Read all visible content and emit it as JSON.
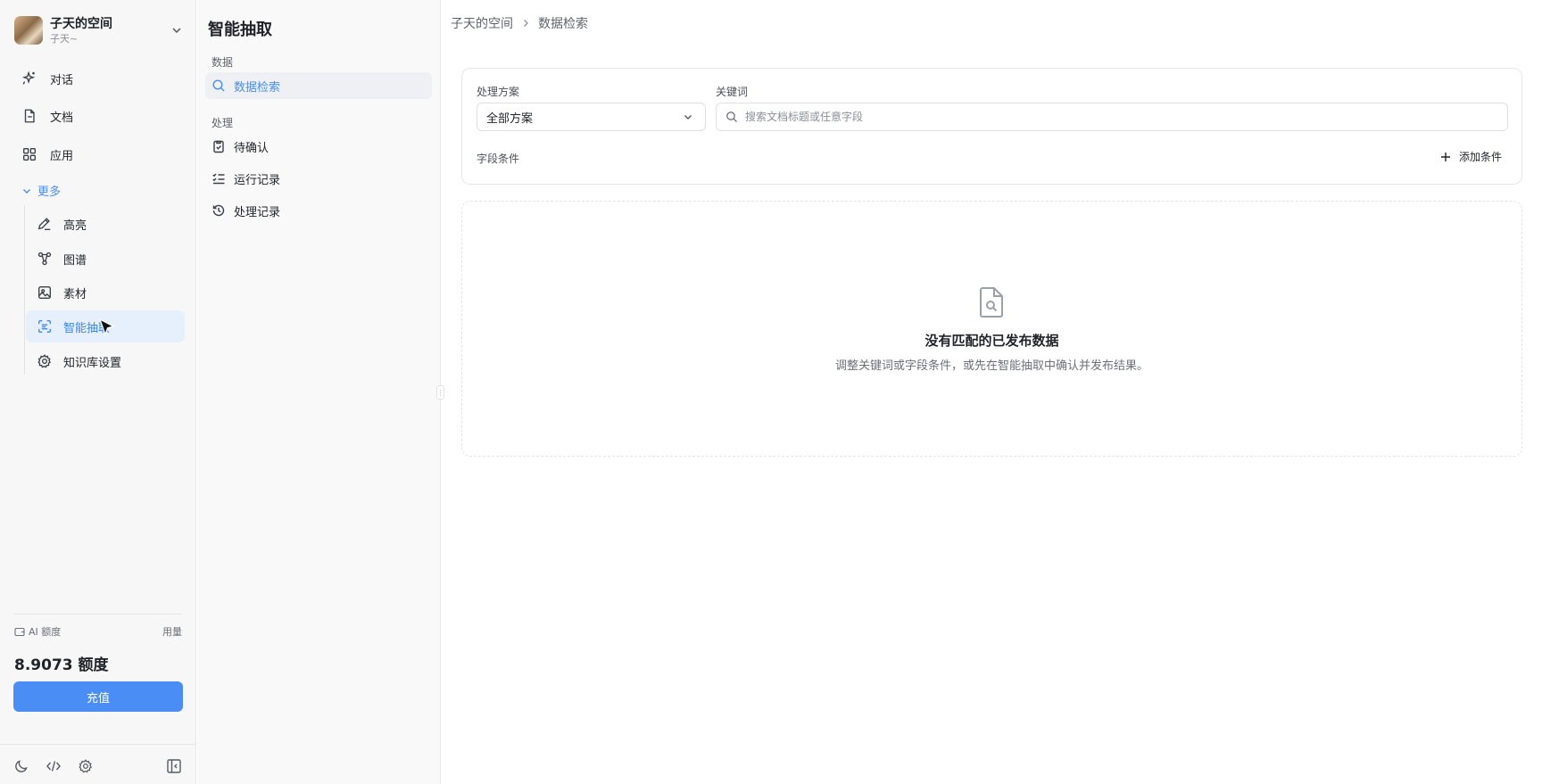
{
  "workspace": {
    "name": "子天的空间",
    "user": "子天~"
  },
  "nav": {
    "chat": "对话",
    "docs": "文档",
    "apps": "应用",
    "more": "更多"
  },
  "more_items": {
    "highlight": "高亮",
    "graph": "图谱",
    "assets": "素材",
    "extract": "智能抽取",
    "kb_settings": "知识库设置"
  },
  "quota": {
    "label": "AI 额度",
    "usage": "用量",
    "value": "8.9073 额度",
    "recharge": "充值"
  },
  "panel": {
    "title": "智能抽取",
    "section_data": "数据",
    "data_search": "数据检索",
    "section_process": "处理",
    "pending": "待确认",
    "run_log": "运行记录",
    "process_log": "处理记录"
  },
  "breadcrumb": {
    "root": "子天的空间",
    "current": "数据检索"
  },
  "filters": {
    "scheme_label": "处理方案",
    "scheme_value": "全部方案",
    "keyword_label": "关键词",
    "keyword_placeholder": "搜索文档标题或任意字段",
    "field_conditions": "字段条件",
    "add_condition": "添加条件"
  },
  "empty": {
    "title": "没有匹配的已发布数据",
    "description": "调整关键词或字段条件，或先在智能抽取中确认并发布结果。"
  },
  "colors": {
    "accent": "#4a8ef5",
    "active_bg": "#e6f0fd"
  }
}
